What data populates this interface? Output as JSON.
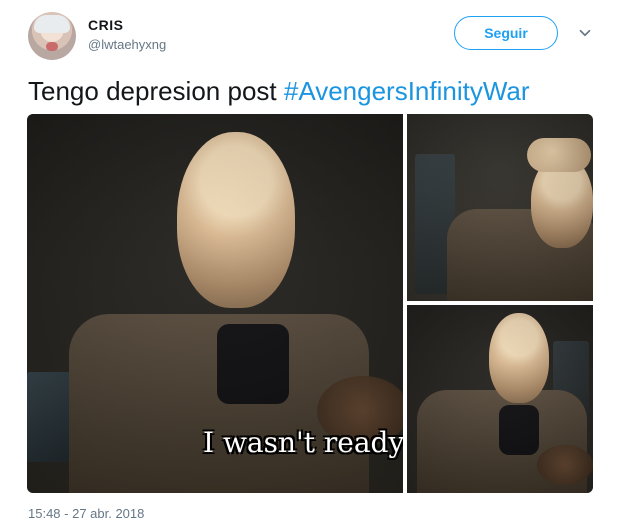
{
  "user": {
    "display_name": "CRIS",
    "handle": "@lwtaehyxng"
  },
  "actions": {
    "follow_label": "Seguir",
    "more_icon": "chevron-down-icon"
  },
  "tweet": {
    "text": "Tengo depresion post",
    "hashtag": "#AvengersInfinityWar",
    "timestamp": "15:48 - 27 abr. 2018"
  },
  "media": {
    "subtitle": "I wasn't ready"
  },
  "colors": {
    "brand_blue": "#1da1f2",
    "link_blue": "#1b95e0",
    "muted": "#657786"
  }
}
